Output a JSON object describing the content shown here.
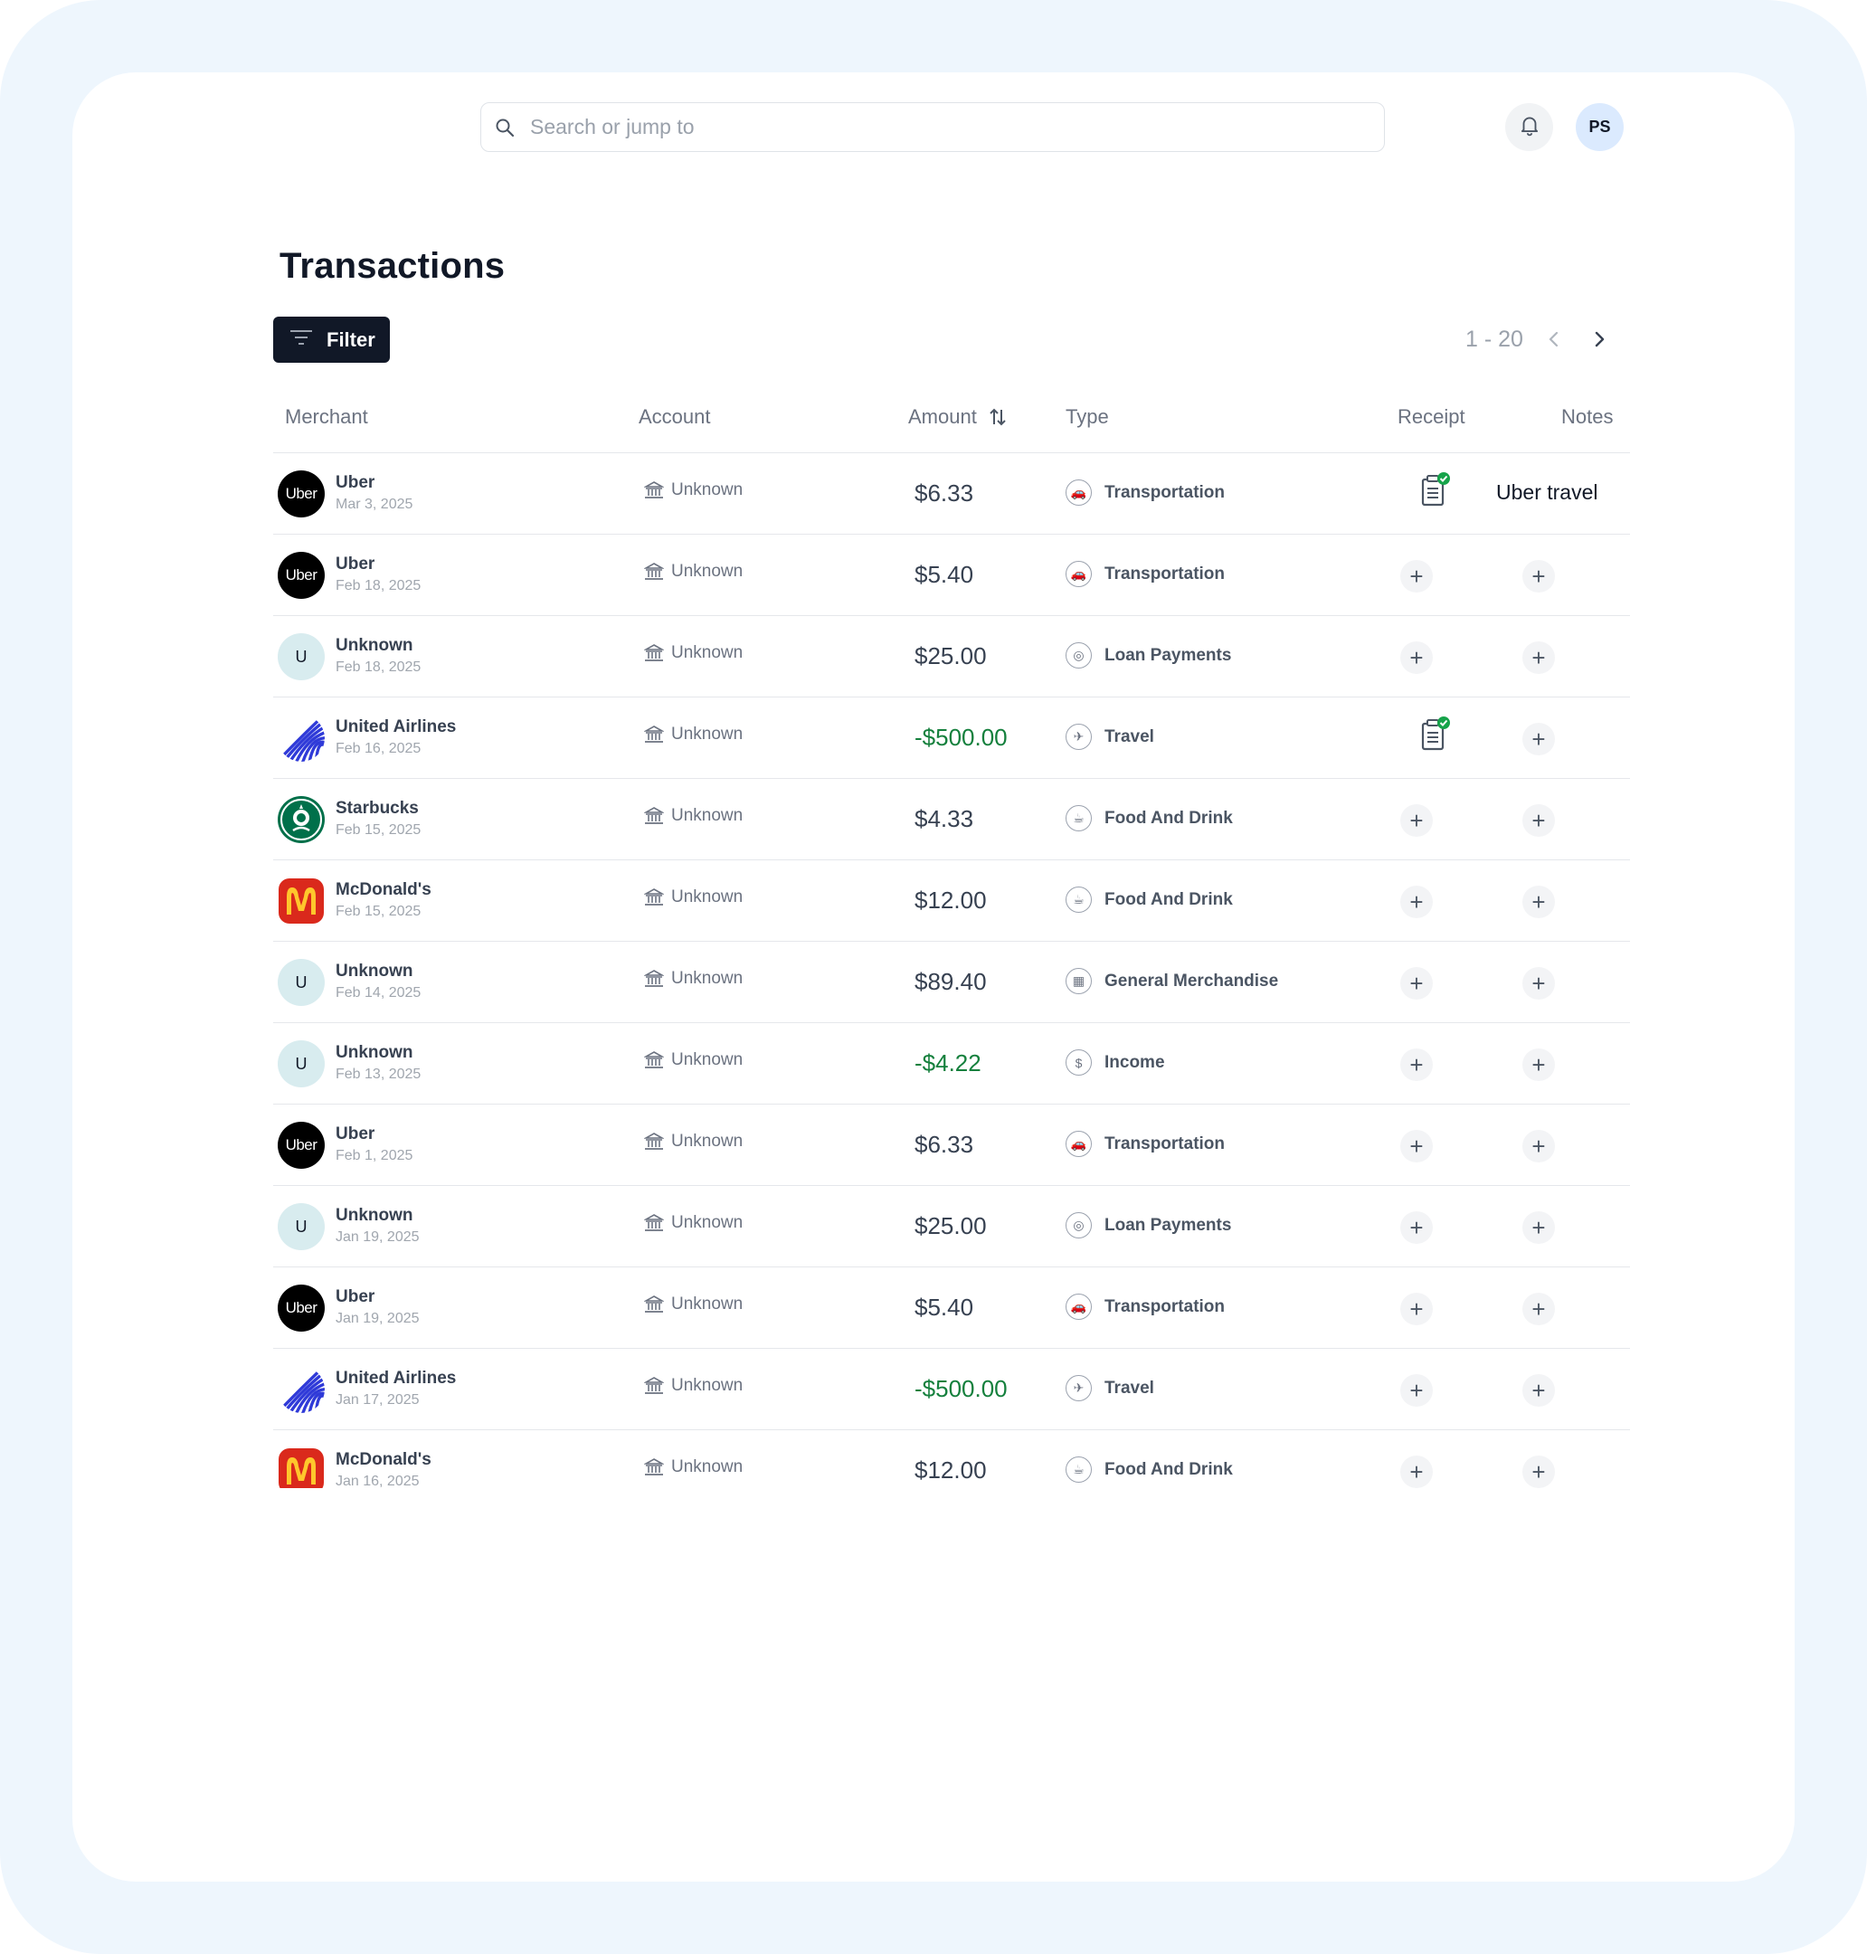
{
  "search": {
    "placeholder": "Search or jump to"
  },
  "user": {
    "initials": "PS"
  },
  "page": {
    "title": "Transactions"
  },
  "toolbar": {
    "filter_label": "Filter"
  },
  "pagination": {
    "range": "1 - 20"
  },
  "table": {
    "headers": {
      "merchant": "Merchant",
      "account": "Account",
      "amount": "Amount",
      "type": "Type",
      "receipt": "Receipt",
      "notes": "Notes"
    },
    "rows": [
      {
        "merchant": "Uber",
        "logo": "uber",
        "date": "Mar 3, 2025",
        "account": "Unknown",
        "amount": "$6.33",
        "negative": false,
        "type": "Transportation",
        "type_icon": "car-icon",
        "receipt": true,
        "note": "Uber travel"
      },
      {
        "merchant": "Uber",
        "logo": "uber",
        "date": "Feb 18, 2025",
        "account": "Unknown",
        "amount": "$5.40",
        "negative": false,
        "type": "Transportation",
        "type_icon": "car-icon",
        "receipt": false,
        "note": ""
      },
      {
        "merchant": "Unknown",
        "logo": "unknown",
        "initial": "U",
        "date": "Feb 18, 2025",
        "account": "Unknown",
        "amount": "$25.00",
        "negative": false,
        "type": "Loan Payments",
        "type_icon": "coins-icon",
        "receipt": false,
        "note": ""
      },
      {
        "merchant": "United Airlines",
        "logo": "united",
        "date": "Feb 16, 2025",
        "account": "Unknown",
        "amount": "-$500.00",
        "negative": true,
        "type": "Travel",
        "type_icon": "suitcase-icon",
        "receipt": true,
        "note": ""
      },
      {
        "merchant": "Starbucks",
        "logo": "starbucks",
        "date": "Feb 15, 2025",
        "account": "Unknown",
        "amount": "$4.33",
        "negative": false,
        "type": "Food And Drink",
        "type_icon": "food-icon",
        "receipt": false,
        "note": ""
      },
      {
        "merchant": "McDonald's",
        "logo": "mcd",
        "date": "Feb 15, 2025",
        "account": "Unknown",
        "amount": "$12.00",
        "negative": false,
        "type": "Food And Drink",
        "type_icon": "food-icon",
        "receipt": false,
        "note": ""
      },
      {
        "merchant": "Unknown",
        "logo": "unknown",
        "initial": "U",
        "date": "Feb 14, 2025",
        "account": "Unknown",
        "amount": "$89.40",
        "negative": false,
        "type": "General Merchandise",
        "type_icon": "shopping-icon",
        "receipt": false,
        "note": ""
      },
      {
        "merchant": "Unknown",
        "logo": "unknown",
        "initial": "U",
        "date": "Feb 13, 2025",
        "account": "Unknown",
        "amount": "-$4.22",
        "negative": true,
        "type": "Income",
        "type_icon": "money-icon",
        "receipt": false,
        "note": ""
      },
      {
        "merchant": "Uber",
        "logo": "uber",
        "date": "Feb 1, 2025",
        "account": "Unknown",
        "amount": "$6.33",
        "negative": false,
        "type": "Transportation",
        "type_icon": "car-icon",
        "receipt": false,
        "note": ""
      },
      {
        "merchant": "Unknown",
        "logo": "unknown",
        "initial": "U",
        "date": "Jan 19, 2025",
        "account": "Unknown",
        "amount": "$25.00",
        "negative": false,
        "type": "Loan Payments",
        "type_icon": "coins-icon",
        "receipt": false,
        "note": ""
      },
      {
        "merchant": "Uber",
        "logo": "uber",
        "date": "Jan 19, 2025",
        "account": "Unknown",
        "amount": "$5.40",
        "negative": false,
        "type": "Transportation",
        "type_icon": "car-icon",
        "receipt": false,
        "note": ""
      },
      {
        "merchant": "United Airlines",
        "logo": "united",
        "date": "Jan 17, 2025",
        "account": "Unknown",
        "amount": "-$500.00",
        "negative": true,
        "type": "Travel",
        "type_icon": "suitcase-icon",
        "receipt": false,
        "note": ""
      },
      {
        "merchant": "McDonald's",
        "logo": "mcd",
        "date": "Jan 16, 2025",
        "account": "Unknown",
        "amount": "$12.00",
        "negative": false,
        "type": "Food And Drink",
        "type_icon": "food-icon",
        "receipt": false,
        "note": ""
      }
    ]
  },
  "logo_text": {
    "uber": "Uber"
  },
  "icons": {
    "search": "search-icon",
    "bell": "bell-icon",
    "filter": "filter-icon",
    "prev": "chevron-left-icon",
    "next": "chevron-right-icon",
    "sort": "sort-icon",
    "bank": "bank-icon",
    "receipt": "receipt-check-icon",
    "add": "plus-icon"
  },
  "colors": {
    "brand_dark": "#111827",
    "negative_amount": "#15803d",
    "receipt_check": "#16a34a",
    "page_background": "#eef6fd"
  }
}
